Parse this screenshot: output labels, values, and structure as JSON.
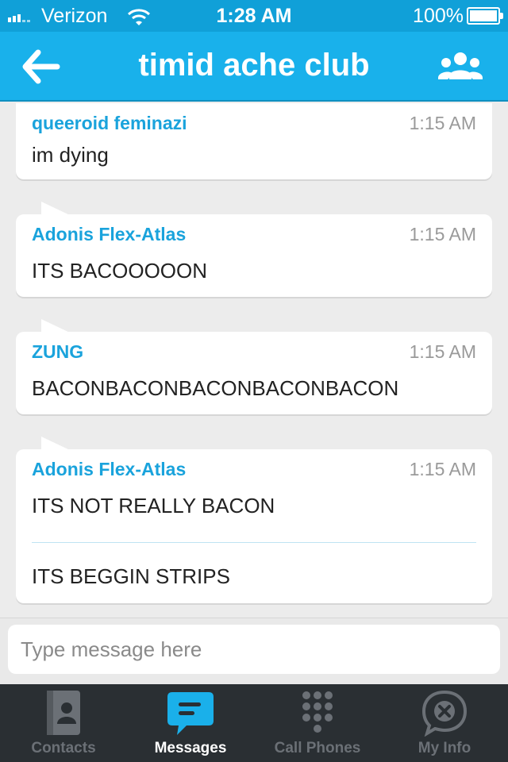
{
  "status_bar": {
    "carrier": "Verizon",
    "time": "1:28 AM",
    "battery": "100%"
  },
  "nav": {
    "title": "timid ache club",
    "back_icon": "back-arrow-icon",
    "group_icon": "group-icon"
  },
  "messages": [
    {
      "sender": "queeroid feminazi",
      "time": "1:15 AM",
      "lines": [
        "im dying"
      ]
    },
    {
      "sender": "Adonis Flex-Atlas",
      "time": "1:15 AM",
      "lines": [
        "ITS BACOOOOON"
      ]
    },
    {
      "sender": "ZUNG",
      "time": "1:15 AM",
      "lines": [
        "BACONBACONBACONBACONBACON"
      ]
    },
    {
      "sender": "Adonis Flex-Atlas",
      "time": "1:15 AM",
      "lines": [
        "ITS NOT REALLY BACON",
        "ITS BEGGIN STRIPS"
      ]
    }
  ],
  "composer": {
    "placeholder": "Type message here"
  },
  "tabs": [
    {
      "label": "Contacts",
      "icon": "contacts-icon",
      "active": false
    },
    {
      "label": "Messages",
      "icon": "messages-icon",
      "active": true
    },
    {
      "label": "Call Phones",
      "icon": "keypad-icon",
      "active": false
    },
    {
      "label": "My Info",
      "icon": "my-info-icon",
      "active": false
    }
  ],
  "colors": {
    "brand": "#19b1eb",
    "sender": "#1aa3dc",
    "tab_bar": "#2a2f33"
  }
}
